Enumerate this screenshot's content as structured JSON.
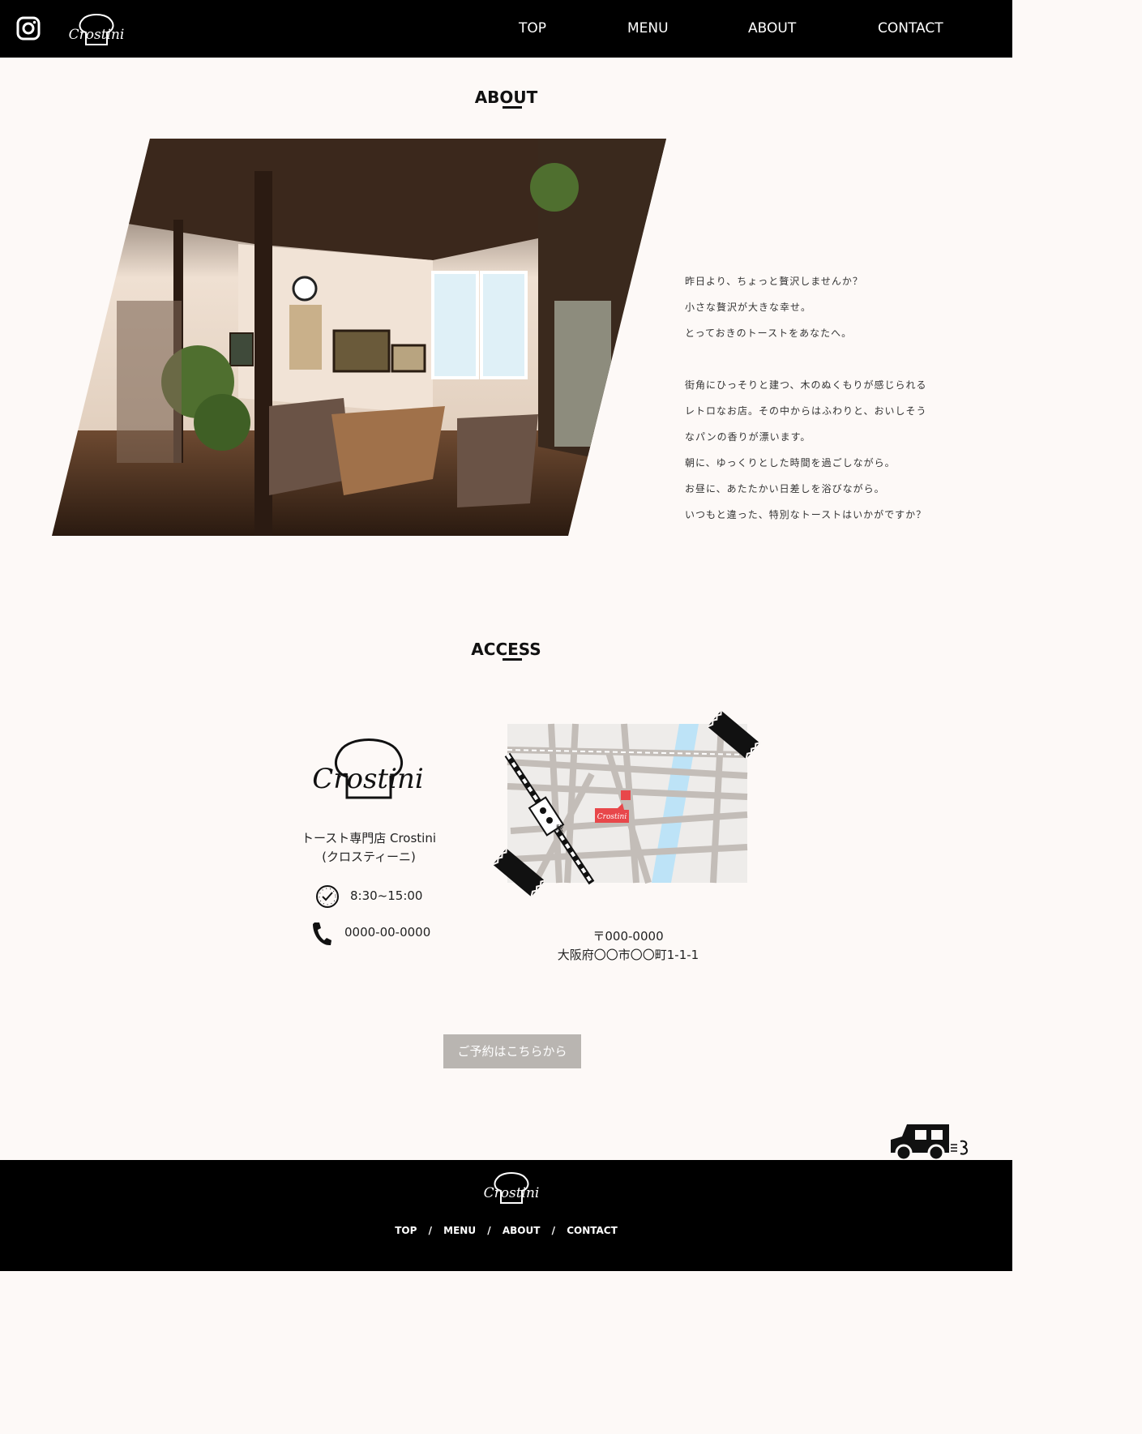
{
  "header": {
    "brand": "Crostini",
    "nav": [
      "TOP",
      "MENU",
      "ABOUT",
      "CONTACT"
    ]
  },
  "about": {
    "title": "ABOUT",
    "lines": [
      "昨日より、ちょっと贅沢しませんか？",
      "小さな贅沢が大きな幸せ。",
      "とっておきのトーストをあなたへ。",
      "",
      "街角にひっそりと建つ、木のぬくもりが感じられる",
      "レトロなお店。その中からはふわりと、おいしそう",
      "なパンの香りが漂います。",
      "朝に、ゆっくりとした時間を過ごしながら。",
      "お昼に、あたたかい日差しを浴びながら。",
      "いつもと違った、特別なトーストはいかがですか？"
    ]
  },
  "access": {
    "title": "ACCESS",
    "brand": "Crostini",
    "shop_name_line1": "トースト専門店 Crostini",
    "shop_name_line2": "(クロスティーニ)",
    "hours": "8:30~15:00",
    "phone": "0000-00-0000",
    "postal": "〒000-0000",
    "address": "大阪府〇〇市〇〇町1-1-1",
    "map_station_label": "駅",
    "map_pin_label": "Crostini",
    "reserve_button": "ご予約はこちらから"
  },
  "footer": {
    "brand": "Crostini",
    "nav": [
      "TOP",
      "MENU",
      "ABOUT",
      "CONTACT"
    ],
    "separator": "/"
  },
  "colors": {
    "background": "#fdf9f7",
    "header": "#000000",
    "button": "#b9b5b1",
    "river": "#bde3f7",
    "pin": "#e8474a"
  },
  "icons": [
    "instagram-icon",
    "clock-icon",
    "phone-icon",
    "truck-icon"
  ]
}
